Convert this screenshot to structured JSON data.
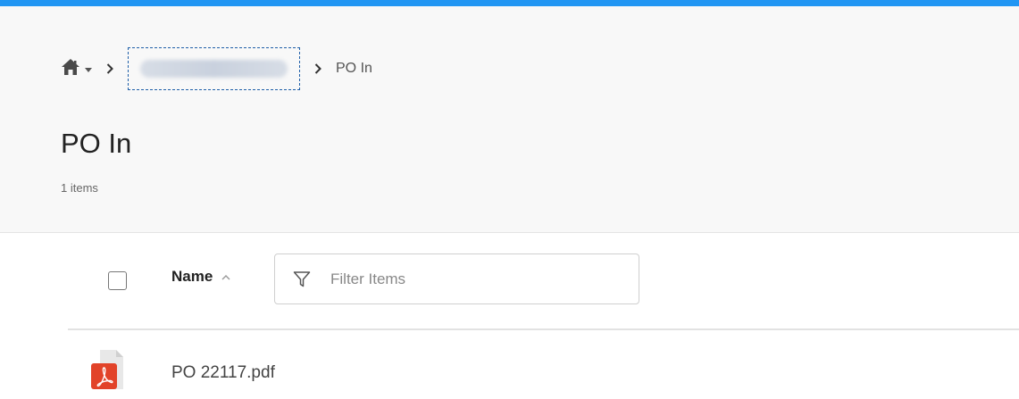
{
  "breadcrumb": {
    "current": "PO In"
  },
  "page": {
    "title": "PO In",
    "item_count": "1 items"
  },
  "toolbar": {
    "sort_label": "Name",
    "filter_placeholder": "Filter Items"
  },
  "files": [
    {
      "name": "PO 22117.pdf",
      "type_icon": "pdf-icon"
    }
  ],
  "colors": {
    "accent_bar": "#2196f3",
    "pdf_red": "#e24329"
  }
}
